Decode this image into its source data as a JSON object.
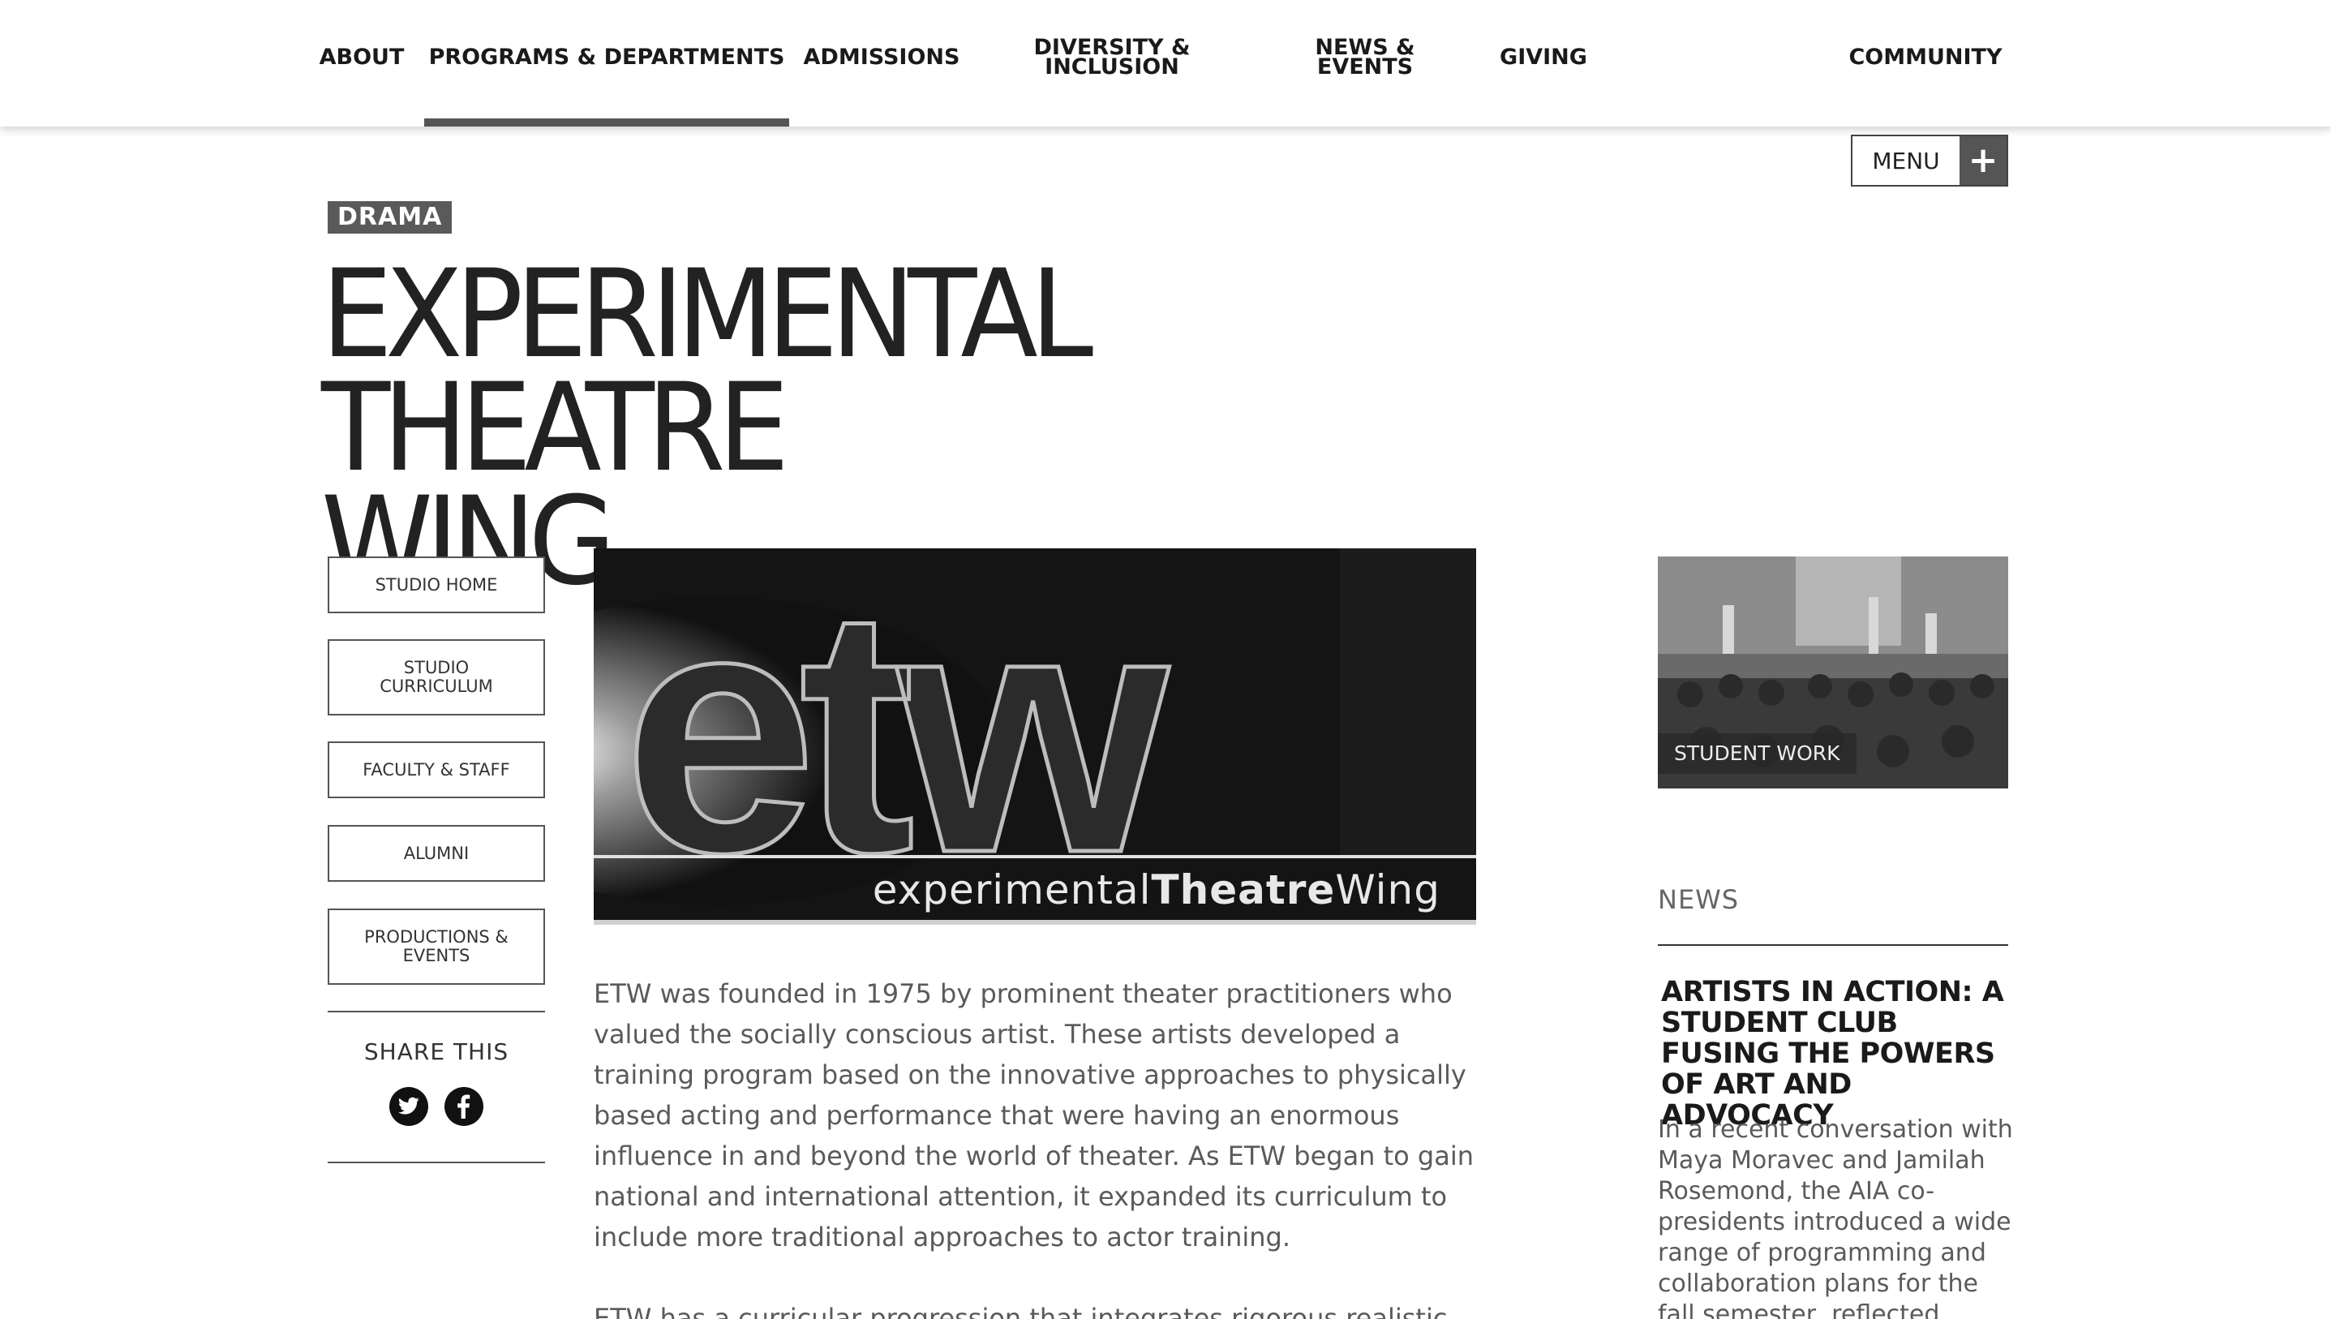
{
  "nav": {
    "about": "ABOUT",
    "programs": "PROGRAMS & DEPARTMENTS",
    "admissions": "ADMISSIONS",
    "diversity_line1": "DIVERSITY &",
    "diversity_line2": "INCLUSION",
    "news": "NEWS & EVENTS",
    "giving": "GIVING",
    "community": "COMMUNITY"
  },
  "menu": {
    "label": "MENU",
    "icon": "plus-icon"
  },
  "page": {
    "tag": "DRAMA",
    "title_line1": "EXPERIMENTAL THEATRE",
    "title_line2": "WING"
  },
  "sidebar": {
    "items": [
      {
        "label": "STUDIO HOME"
      },
      {
        "label": "STUDIO CURRICULUM"
      },
      {
        "label": "FACULTY & STAFF"
      },
      {
        "label": "ALUMNI"
      },
      {
        "label": "PRODUCTIONS & EVENTS"
      }
    ],
    "share_title": "SHARE THIS",
    "share_icons": [
      "twitter-icon",
      "facebook-icon"
    ]
  },
  "hero": {
    "logo_word": "etw",
    "caption_regular": "experimental",
    "caption_bold": "Theatre",
    "caption_end": "Wing"
  },
  "body": {
    "paragraph1": "ETW was founded in 1975 by prominent theater practitioners who valued the socially conscious artist. These artists developed a training program based on the innovative approaches to physically based acting and performance that were having an enormous influence in and beyond the world of theater. As ETW began to gain national and international attention, it expanded its curriculum to include more traditional approaches to actor training.",
    "paragraph2": "ETW has a curricular progression that integrates rigorous realistic"
  },
  "right": {
    "student_work_label": "STUDENT WORK",
    "news_heading": "NEWS",
    "news_title": "ARTISTS IN ACTION: A STUDENT CLUB FUSING THE POWERS OF ART AND ADVOCACY",
    "news_excerpt": "In a recent conversation with Maya Moravec and Jamilah Rosemond, the AIA co-presidents introduced a wide range of programming and collaboration plans for the fall semester, reflected"
  }
}
